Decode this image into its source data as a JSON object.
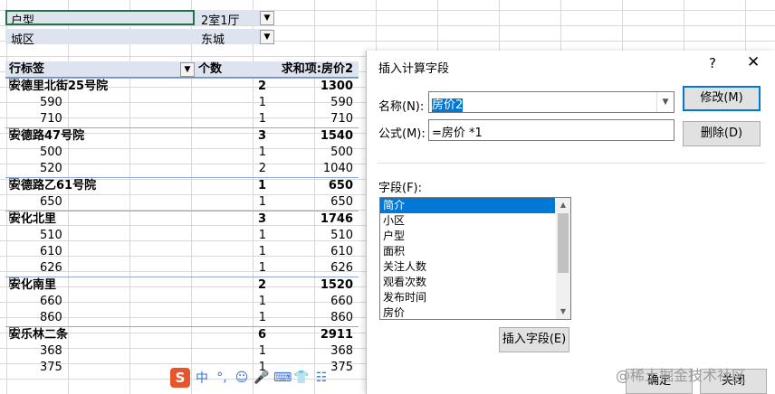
{
  "filters": [
    {
      "label": "户型",
      "value": "2室1厅"
    },
    {
      "label": "城区",
      "value": "东城"
    }
  ],
  "pivot": {
    "headers": {
      "row_label": "行标签",
      "count": "个数",
      "sum": "求和项:房价2"
    },
    "rows": [
      {
        "level": 1,
        "label": "安德里北街25号院",
        "count": "2",
        "sum": "1300"
      },
      {
        "level": 2,
        "label": "590",
        "count": "1",
        "sum": "590"
      },
      {
        "level": 2,
        "label": "710",
        "count": "1",
        "sum": "710"
      },
      {
        "level": 1,
        "label": "安德路47号院",
        "count": "3",
        "sum": "1540"
      },
      {
        "level": 2,
        "label": "500",
        "count": "1",
        "sum": "500"
      },
      {
        "level": 2,
        "label": "520",
        "count": "2",
        "sum": "1040"
      },
      {
        "level": 1,
        "label": "安德路乙61号院",
        "count": "1",
        "sum": "650"
      },
      {
        "level": 2,
        "label": "650",
        "count": "1",
        "sum": "650"
      },
      {
        "level": 1,
        "label": "安化北里",
        "count": "3",
        "sum": "1746"
      },
      {
        "level": 2,
        "label": "510",
        "count": "1",
        "sum": "510"
      },
      {
        "level": 2,
        "label": "610",
        "count": "1",
        "sum": "610"
      },
      {
        "level": 2,
        "label": "626",
        "count": "1",
        "sum": "626"
      },
      {
        "level": 1,
        "label": "安化南里",
        "count": "2",
        "sum": "1520"
      },
      {
        "level": 2,
        "label": "660",
        "count": "1",
        "sum": "660"
      },
      {
        "level": 2,
        "label": "860",
        "count": "1",
        "sum": "860"
      },
      {
        "level": 1,
        "label": "安乐林二条",
        "count": "6",
        "sum": "2911"
      },
      {
        "level": 2,
        "label": "368",
        "count": "1",
        "sum": "368"
      },
      {
        "level": 2,
        "label": "375",
        "count": "1",
        "sum": "375"
      }
    ]
  },
  "dialog": {
    "title": "插入计算字段",
    "help": "?",
    "close": "✕",
    "name_label": "名称(N):",
    "name_value": "房价2",
    "formula_label": "公式(M):",
    "formula_value": "=房价 *1",
    "modify_btn": "修改(M)",
    "delete_btn": "删除(D)",
    "fields_label": "字段(F):",
    "fields": [
      "简介",
      "小区",
      "户型",
      "面积",
      "关注人数",
      "观看次数",
      "发布时间",
      "房价"
    ],
    "selected_field": "简介",
    "insert_field_btn": "插入字段(E)",
    "ok_btn": "确定",
    "cancel_btn": "关闭"
  },
  "ime": {
    "logo": "S",
    "mode": "中",
    "punct": "°,",
    "items": [
      "☺",
      "🎤",
      "⌨",
      "👕",
      "☷"
    ]
  },
  "watermark": "@稀土掘金技术社区",
  "colors": {
    "accent": "#0078d7",
    "pivot_header": "#dde4f0",
    "excel_green": "#217346"
  }
}
